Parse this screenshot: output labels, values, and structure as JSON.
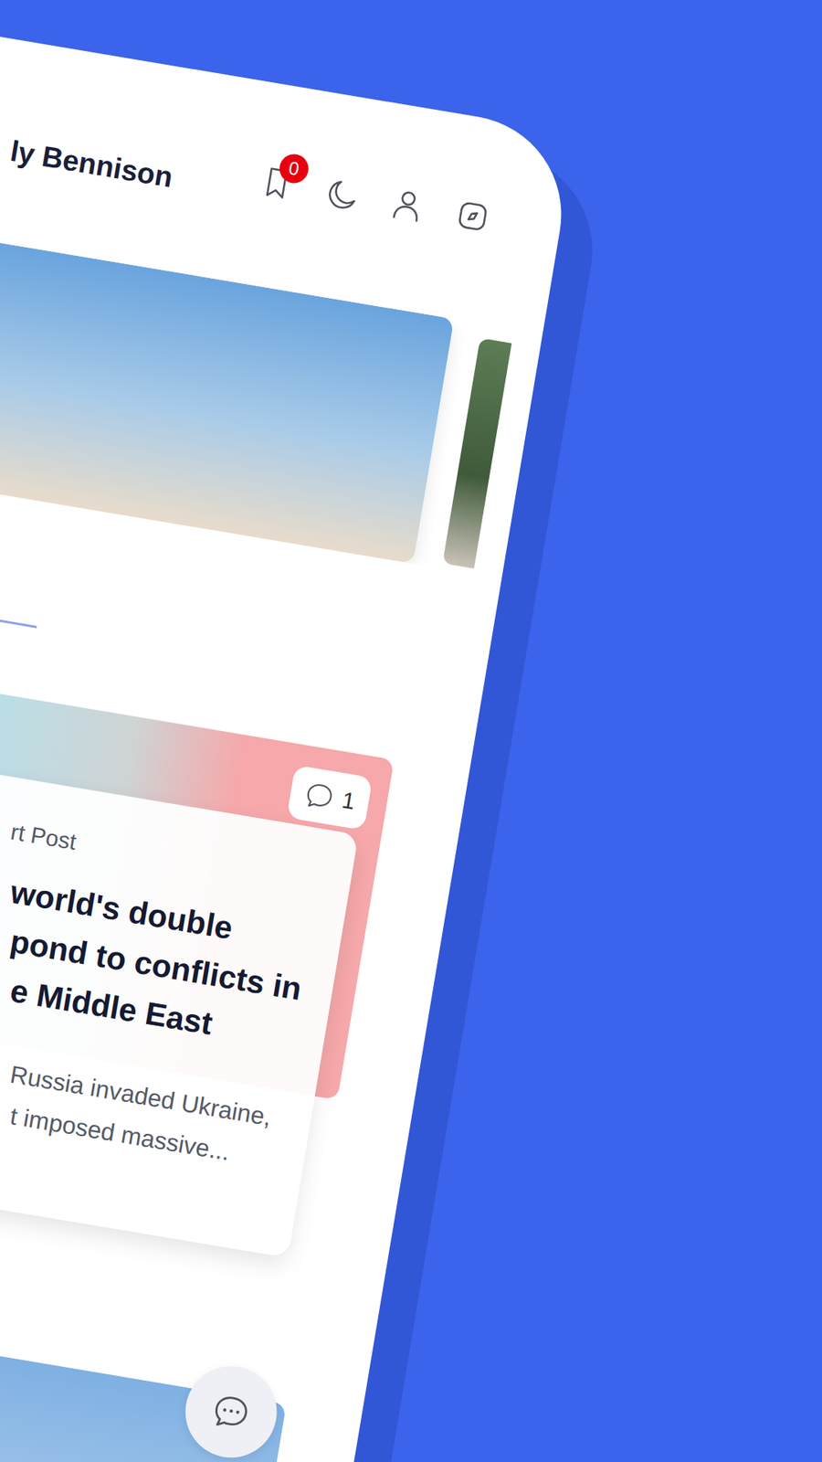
{
  "header": {
    "title": "ly Bennison",
    "bookmark_count": "0"
  },
  "article": {
    "comments": "1",
    "source": "rt Post",
    "title_lines": [
      "world's double",
      "pond to conflicts in",
      "e Middle East"
    ],
    "excerpt_lines": [
      "Russia invaded Ukraine,",
      "t imposed massive..."
    ]
  }
}
